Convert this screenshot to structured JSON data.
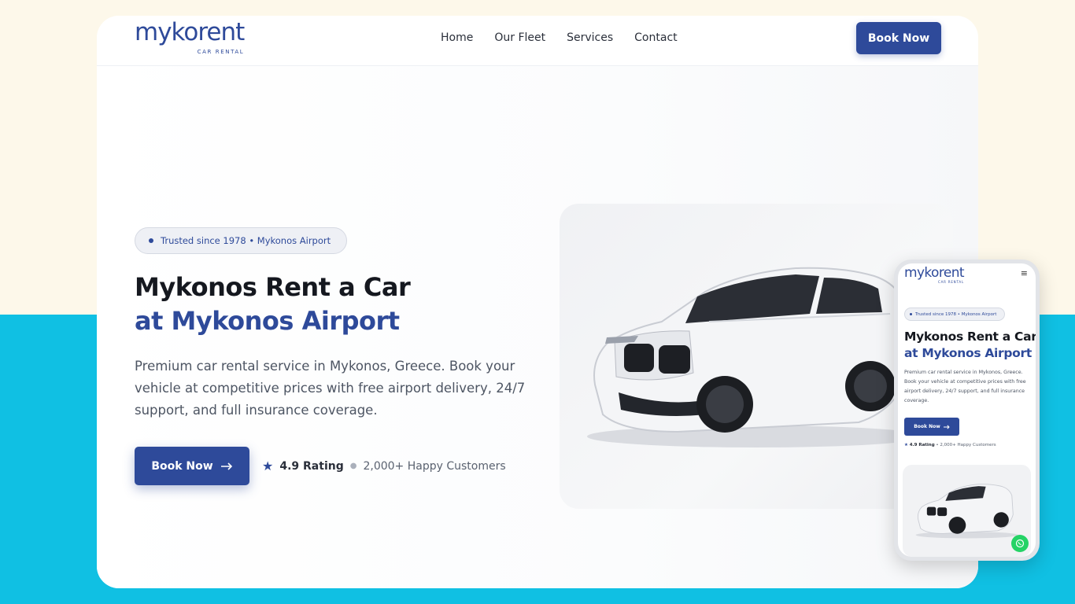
{
  "brand": {
    "name": "mykorent",
    "tagline": "CAR RENTAL"
  },
  "nav": {
    "items": [
      "Home",
      "Our Fleet",
      "Services",
      "Contact"
    ],
    "book_label": "Book Now"
  },
  "hero": {
    "badge": "Trusted since 1978 • Mykonos Airport",
    "title_line1": "Mykonos Rent a Car",
    "title_line2": "at Mykonos Airport",
    "description": "Premium car rental service in Mykonos, Greece. Book your vehicle at competitive prices with free airport delivery, 24/7 support, and full insurance coverage.",
    "cta_label": "Book Now",
    "rating": "4.9 Rating",
    "customers": "2,000+ Happy Customers"
  },
  "mobile": {
    "brand_name": "mykorent",
    "brand_tagline": "CAR RENTAL",
    "badge": "Trusted since 1978 • Mykonos Airport",
    "title_line1": "Mykonos Rent a Car",
    "title_line2": "at Mykonos Airport",
    "description": "Premium car rental service in Mykonos, Greece. Book your vehicle at competitive prices with free airport delivery, 24/7 support, and full insurance coverage.",
    "cta_label": "Book Now",
    "rating": "4.9 Rating",
    "customers": "2,000+ Happy Customers"
  },
  "colors": {
    "accent": "#2e4a9a",
    "top_background": "#fdf8ea",
    "bottom_background": "#10c0e3",
    "whatsapp": "#25d366"
  },
  "icons": {
    "cta_arrow": "arrow-right-icon",
    "rating": "star-icon",
    "menu": "hamburger-icon",
    "chat": "whatsapp-icon"
  }
}
